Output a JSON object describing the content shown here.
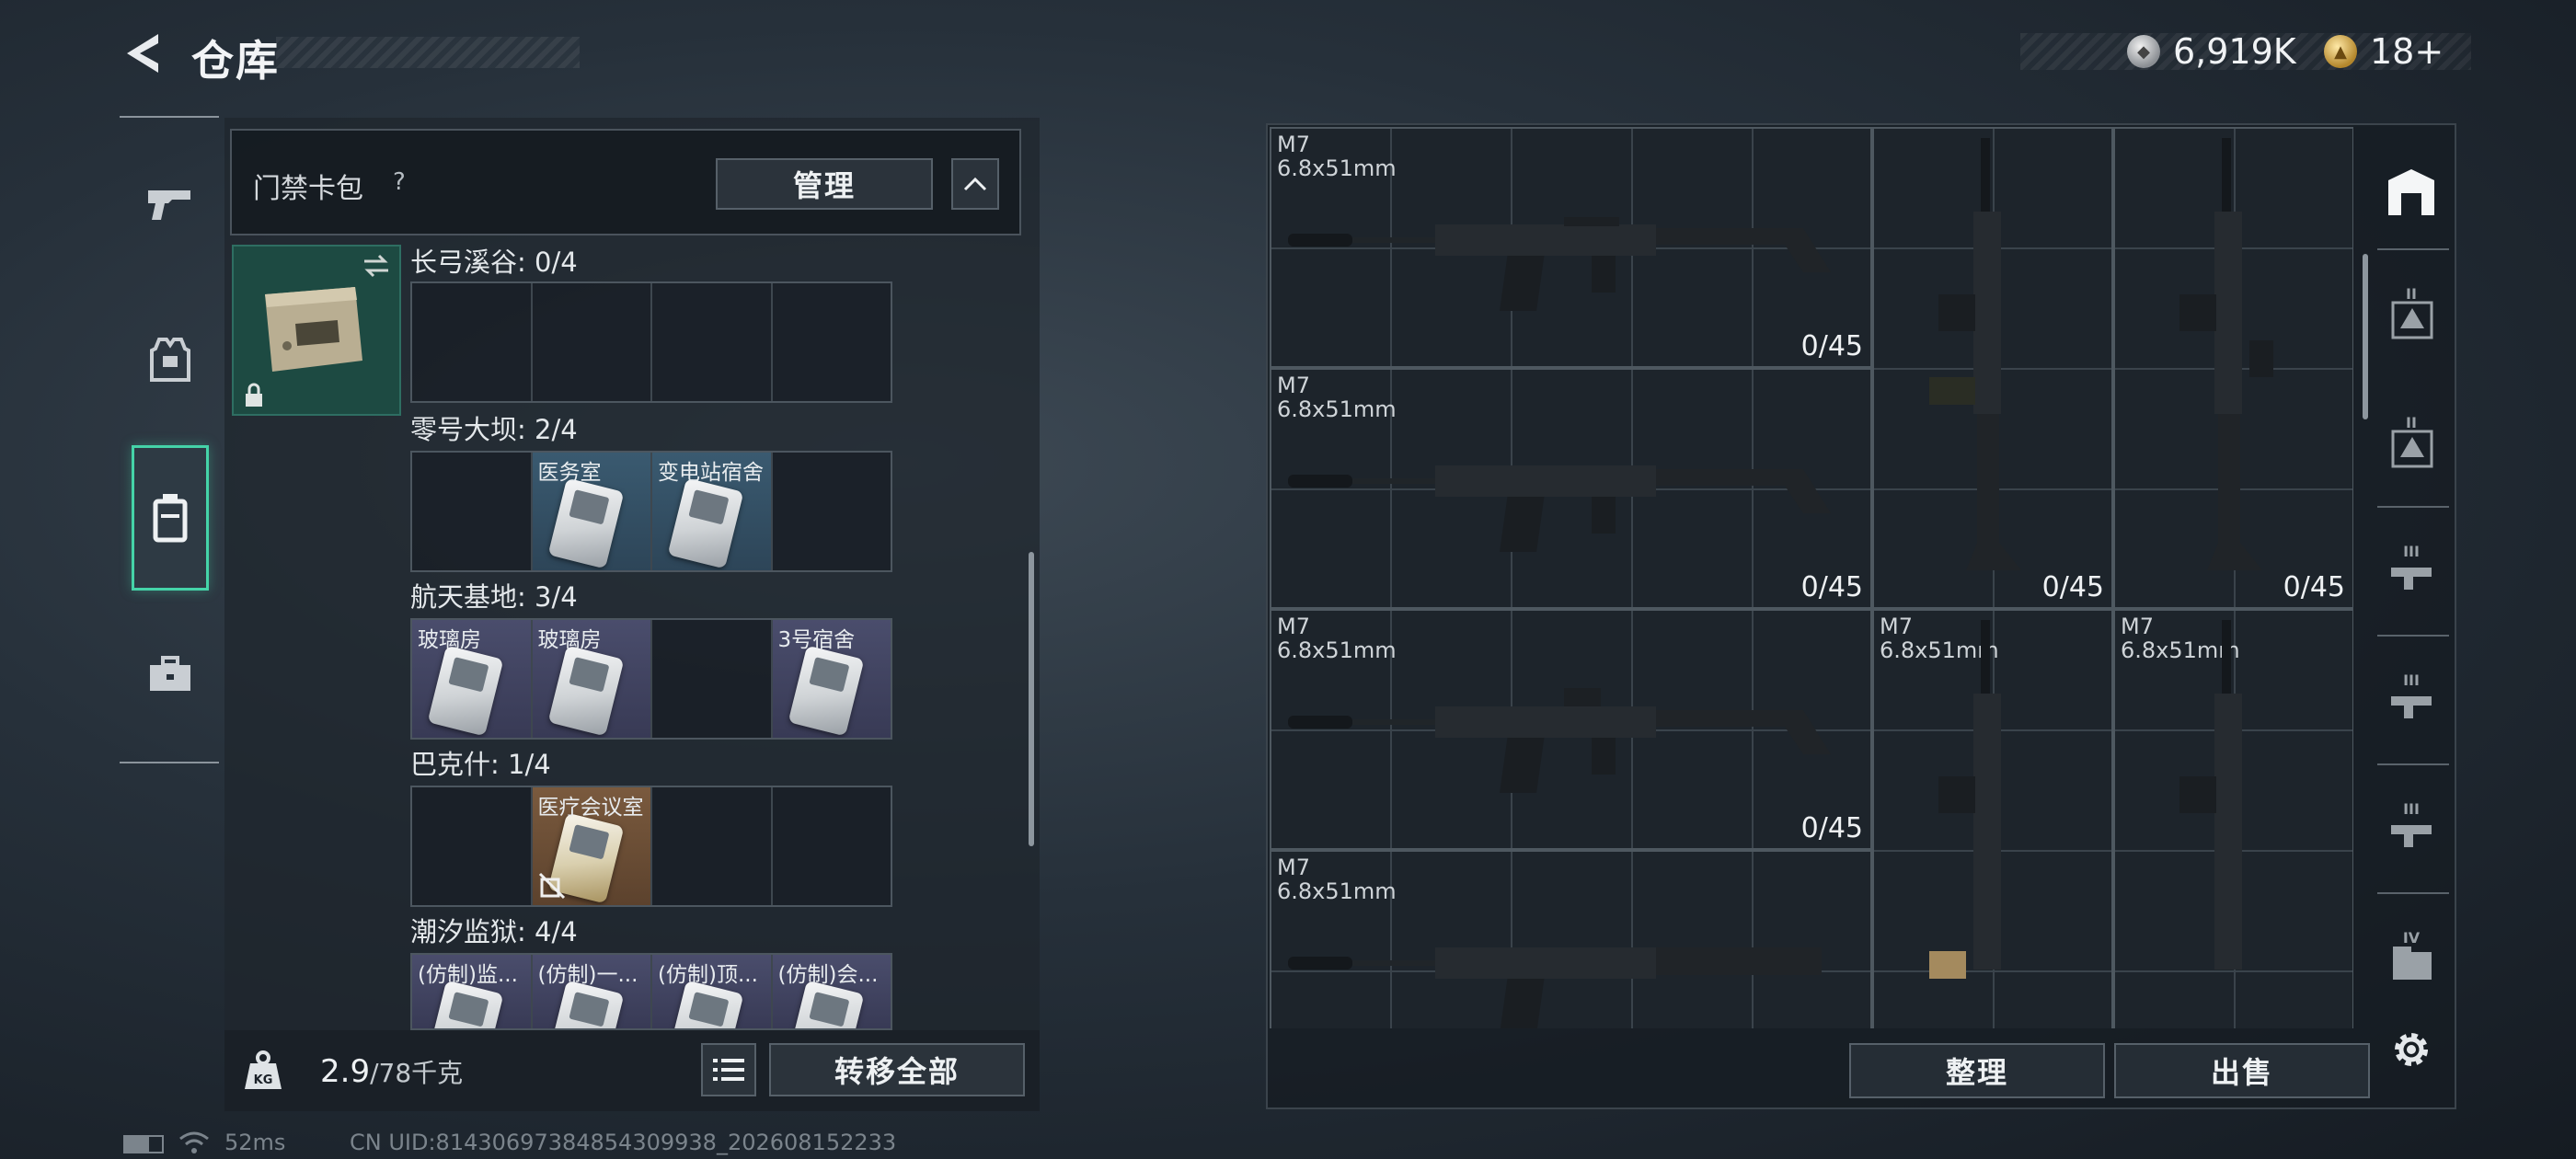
{
  "header": {
    "title": "仓库",
    "currency_silver": "6,919K",
    "currency_gold": "18+"
  },
  "keycard_section": {
    "label": "门禁卡包",
    "help": "?",
    "manage_label": "管理"
  },
  "locations": [
    {
      "title": "长弓溪谷: 0/4",
      "slots": [
        {
          "label": "",
          "color": "empty"
        },
        {
          "label": "",
          "color": "empty"
        },
        {
          "label": "",
          "color": "empty"
        },
        {
          "label": "",
          "color": "empty"
        }
      ]
    },
    {
      "title": "零号大坝: 2/4",
      "slots": [
        {
          "label": "",
          "color": "empty"
        },
        {
          "label": "医务室",
          "color": "blue"
        },
        {
          "label": "变电站宿舍",
          "color": "blue"
        },
        {
          "label": "",
          "color": "empty"
        }
      ]
    },
    {
      "title": "航天基地: 3/4",
      "slots": [
        {
          "label": "玻璃房",
          "color": "purple"
        },
        {
          "label": "玻璃房",
          "color": "purple"
        },
        {
          "label": "",
          "color": "empty"
        },
        {
          "label": "3号宿舍",
          "color": "purple"
        }
      ]
    },
    {
      "title": "巴克什: 1/4",
      "slots": [
        {
          "label": "",
          "color": "empty"
        },
        {
          "label": "医疗会议室",
          "color": "orange"
        },
        {
          "label": "",
          "color": "empty"
        },
        {
          "label": "",
          "color": "empty"
        }
      ]
    },
    {
      "title": "潮汐监狱: 4/4",
      "slots": [
        {
          "label": "(仿制)监...",
          "color": "purple"
        },
        {
          "label": "(仿制)一...",
          "color": "purple"
        },
        {
          "label": "(仿制)顶...",
          "color": "purple"
        },
        {
          "label": "(仿制)会...",
          "color": "purple"
        }
      ]
    }
  ],
  "capacity": {
    "current": "2.9",
    "max": "/78千克"
  },
  "buttons": {
    "transfer_all": "转移全部",
    "sort": "整理",
    "sell": "出售"
  },
  "status_bar": {
    "ping": "52ms",
    "uid": "CN UID:8143069738485430993​8_202608152233"
  },
  "weapons": [
    {
      "name": "M7",
      "caliber": "6.8x51mm",
      "ammo": "0/45"
    },
    {
      "name": "M7",
      "caliber": "6.8x51mm",
      "ammo": "0/45"
    },
    {
      "name": "",
      "caliber": "",
      "ammo": "0/45"
    },
    {
      "name": "",
      "caliber": "",
      "ammo": "0/45"
    },
    {
      "name": "M7",
      "caliber": "6.8x51mm",
      "ammo": "0/45"
    },
    {
      "name": "M7",
      "caliber": "6.8x51mm",
      "ammo": ""
    },
    {
      "name": "M7",
      "caliber": "6.8x51mm",
      "ammo": ""
    },
    {
      "name": "M7",
      "caliber": "6.8x51mm",
      "ammo": ""
    }
  ],
  "side_tiers": [
    "II",
    "II",
    "III",
    "III",
    "III",
    "IV"
  ],
  "colors": {
    "accent": "#45d3a8",
    "rarity_blue": "#3a5a70",
    "rarity_purple": "#4a4d6c",
    "rarity_orange": "#7a5a3e"
  }
}
